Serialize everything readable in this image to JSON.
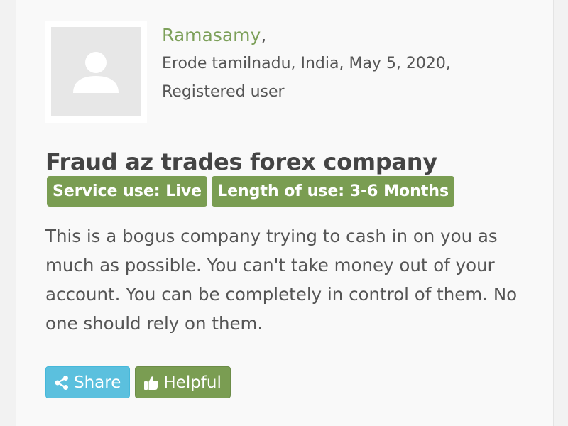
{
  "review": {
    "author": {
      "name": "Ramasamy",
      "name_suffix": ",",
      "location_date": "Erode tamilnadu, India, May 5, 2020,",
      "user_type": "Registered user",
      "avatar_icon": "user-silhouette-icon"
    },
    "title": "Fraud az trades forex company",
    "badges": [
      "Service use: Live",
      "Length of use: 3-6 Months"
    ],
    "text": "This is a bogus company trying to cash in on you as much as possible. You can't take money out of your account. You can be completely in control of them. No one should rely on them.",
    "actions": {
      "share_label": "Share",
      "share_icon": "share-icon",
      "helpful_label": "Helpful",
      "helpful_icon": "thumbs-up-icon"
    }
  },
  "colors": {
    "accent_green": "#7a9d52",
    "author_green": "#7da05a",
    "share_blue": "#5bc0de",
    "text_gray": "#555555",
    "title_gray": "#444444"
  }
}
